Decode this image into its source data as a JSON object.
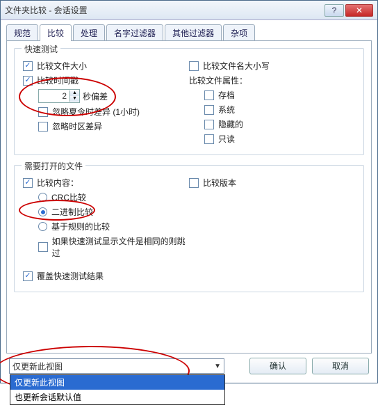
{
  "title": "文件夹比较 - 会话设置",
  "titlebar": {
    "help": "?",
    "close": "✕"
  },
  "tabs": [
    "规范",
    "比较",
    "处理",
    "名字过滤器",
    "其他过滤器",
    "杂项"
  ],
  "active_tab": 1,
  "group_quick": {
    "title": "快速测试",
    "compare_size": "比较文件大小",
    "compare_timestamp": "比较时间戳",
    "spinner_value": "2",
    "seconds_offset": "秒偏差",
    "ignore_dst": "忽略夏令时差异 (1小时)",
    "ignore_tz": "忽略时区差异",
    "compare_case": "比较文件名大小写",
    "compare_attrs_label": "比较文件属性：",
    "archive": "存档",
    "system": "系统",
    "hidden": "隐藏的",
    "readonly": "只读"
  },
  "group_open": {
    "title": "需要打开的文件",
    "compare_content": "比较内容：",
    "crc": "CRC比较",
    "binary": "二进制比较",
    "rule": "基于规则的比较",
    "skip_same": "如果快速测试显示文件是相同的则跳过",
    "override": "覆盖快速测试结果",
    "compare_version": "比较版本"
  },
  "dropdown": {
    "selected": "仅更新此视图",
    "options": [
      "仅更新此视图",
      "也更新会话默认值"
    ]
  },
  "buttons": {
    "ok": "确认",
    "cancel": "取消"
  }
}
